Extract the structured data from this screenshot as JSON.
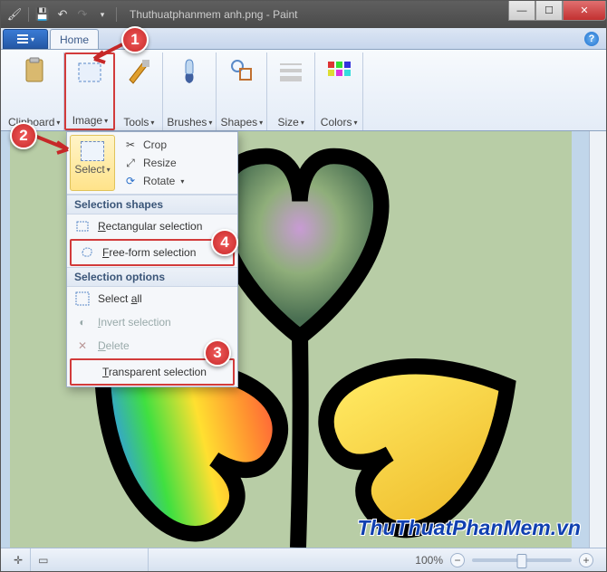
{
  "title": "Thuthuatphanmem anh.png - Paint",
  "tabs": {
    "home": "Home"
  },
  "ribbon": {
    "clipboard": "Clipboard",
    "image": "Image",
    "tools": "Tools",
    "brushes": "Brushes",
    "shapes": "Shapes",
    "size": "Size",
    "colors": "Colors"
  },
  "dropdown": {
    "select": "Select",
    "crop": "Crop",
    "resize": "Resize",
    "rotate": "Rotate",
    "sect_shapes": "Selection shapes",
    "rect_sel": "Rectangular selection",
    "free_sel": "Free-form selection",
    "sect_options": "Selection options",
    "select_all": "Select all",
    "invert": "Invert selection",
    "delete": "Delete",
    "transparent": "Transparent selection"
  },
  "status": {
    "zoom": "100%"
  },
  "watermark": "ThuThuatPhanMem.vn",
  "ann": {
    "a1": "1",
    "a2": "2",
    "a3": "3",
    "a4": "4"
  }
}
